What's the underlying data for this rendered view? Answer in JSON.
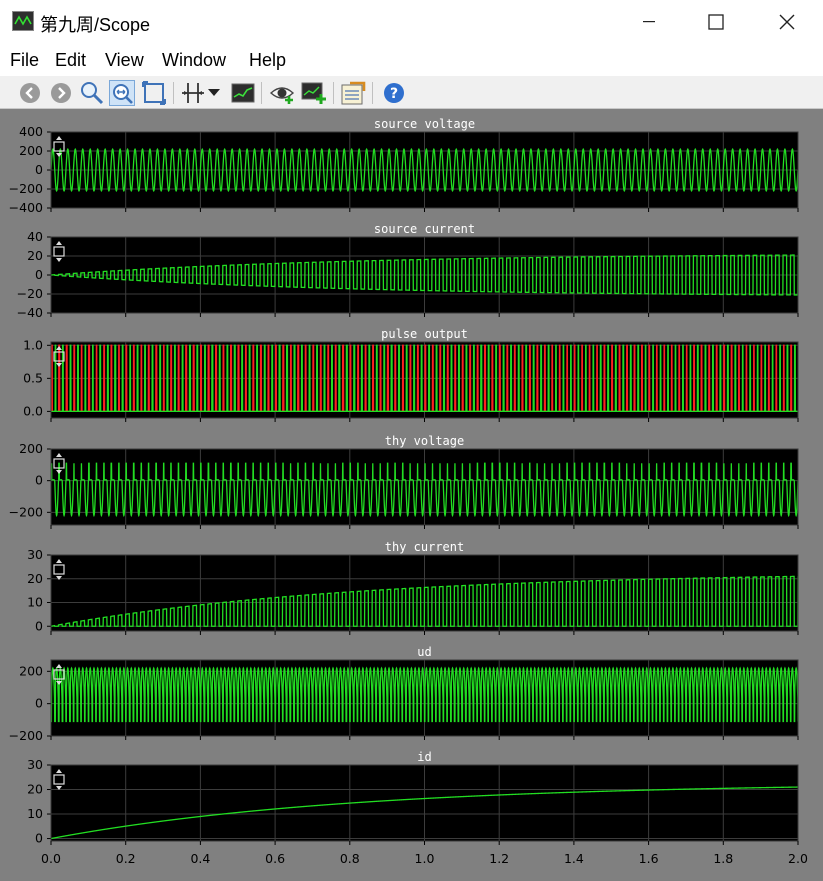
{
  "window": {
    "title": "第九周/Scope",
    "controls": {
      "minimize": "—",
      "maximize": "☐",
      "close": "✕"
    }
  },
  "menu": [
    "File",
    "Edit",
    "View",
    "Window",
    "Help"
  ],
  "toolbar": {
    "icons": [
      "back-icon",
      "forward-icon",
      "zoom-icon",
      "zoom-x-icon",
      "zoom-xy-icon",
      "cursor-measure-icon",
      "dropdown-arrow-icon",
      "scope-params-icon",
      "signal-select-icon",
      "add-signal-icon",
      "data-history-icon",
      "help-icon"
    ]
  },
  "colors": {
    "plot_bg": "#000000",
    "figure_bg": "#808080",
    "trace_green": "#22dd22",
    "trace_red": "#ff2020",
    "grid": "#3c3c3c",
    "text": "#000000"
  },
  "chart_data": [
    {
      "type": "line",
      "title": "source voltage",
      "yticks": [
        400,
        200,
        0,
        -200,
        -400
      ],
      "ylim": [
        -400,
        400
      ],
      "xlim": [
        0,
        2
      ],
      "series": [
        {
          "color": "#22dd22",
          "amplitude": 220,
          "offset": 0,
          "envelope": "constant",
          "waveform": "sine",
          "frequency_hz": 50
        }
      ]
    },
    {
      "type": "line",
      "title": "source current",
      "yticks": [
        40,
        20,
        0,
        -20,
        -40
      ],
      "ylim": [
        -40,
        40
      ],
      "xlim": [
        0,
        2
      ],
      "series": [
        {
          "color": "#22dd22",
          "amplitude": 21,
          "offset": 0,
          "envelope": "rising",
          "waveform": "square-bipolar",
          "frequency_hz": 50
        }
      ]
    },
    {
      "type": "line",
      "title": "pulse output",
      "yticks": [
        "1.0",
        "0.5",
        "0.0"
      ],
      "ylim": [
        -0.1,
        1.05
      ],
      "xlim": [
        0,
        2
      ],
      "series": [
        {
          "color": "#ff2020",
          "values_range": [
            0,
            1
          ],
          "waveform": "pulse",
          "frequency_hz": 50
        },
        {
          "color": "#22dd22",
          "values_range": [
            0,
            1
          ],
          "waveform": "pulse",
          "frequency_hz": 50
        }
      ]
    },
    {
      "type": "line",
      "title": "thy voltage",
      "yticks": [
        200,
        0,
        -200
      ],
      "ylim": [
        -280,
        200
      ],
      "xlim": [
        0,
        2
      ],
      "series": [
        {
          "color": "#22dd22",
          "values_range": [
            -220,
            110
          ],
          "waveform": "thyristor-voltage",
          "frequency_hz": 50
        }
      ]
    },
    {
      "type": "line",
      "title": "thy current",
      "yticks": [
        30,
        20,
        10,
        0
      ],
      "ylim": [
        -2,
        30
      ],
      "xlim": [
        0,
        2
      ],
      "series": [
        {
          "color": "#22dd22",
          "amplitude": 21,
          "offset": 0,
          "envelope": "rising",
          "waveform": "square-unipolar",
          "frequency_hz": 50
        }
      ]
    },
    {
      "type": "line",
      "title": "ud",
      "yticks": [
        200,
        0,
        -200
      ],
      "ylim": [
        -200,
        270
      ],
      "xlim": [
        0,
        2
      ],
      "series": [
        {
          "color": "#22dd22",
          "values_range": [
            -110,
            220
          ],
          "waveform": "rectified",
          "frequency_hz": 100
        }
      ]
    },
    {
      "type": "line",
      "title": "id",
      "yticks": [
        30,
        20,
        10,
        0
      ],
      "ylim": [
        -1,
        30
      ],
      "xlim": [
        0,
        2
      ],
      "x_tick_labels": [
        "0.0",
        "0.2",
        "0.4",
        "0.6",
        "0.8",
        "1.0",
        "1.2",
        "1.4",
        "1.6",
        "1.8",
        "2.0"
      ],
      "series": [
        {
          "color": "#22dd22",
          "start": 0,
          "end": 21,
          "waveform": "exponential-rise",
          "time_constant": 0.8
        }
      ]
    }
  ]
}
